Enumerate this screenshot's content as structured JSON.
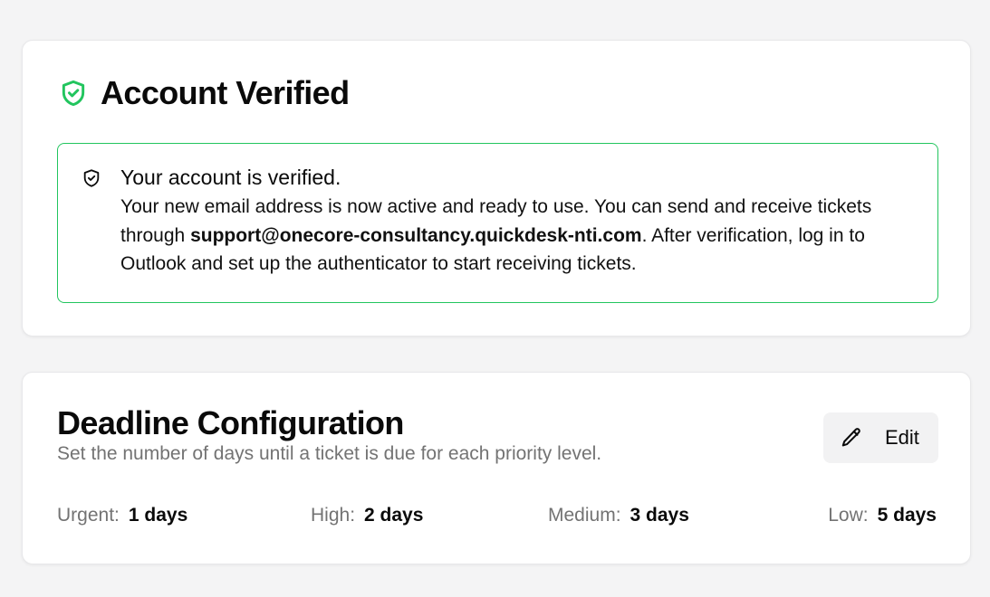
{
  "verified_card": {
    "title": "Account Verified",
    "title_icon": "shield-check-icon",
    "accent_color": "#22c55e",
    "alert": {
      "icon": "shield-check-icon",
      "heading": "Your account is verified.",
      "text_before": "Your new email address is now active and ready to use. You can send and receive tickets through ",
      "email": "support@onecore-consultancy.quickdesk-nti.com",
      "text_after": ". After verification, log in to Outlook and set up the authenticator to start receiving tickets."
    }
  },
  "deadline_card": {
    "title": "Deadline Configuration",
    "subtitle": "Set the number of days until a ticket is due for each priority level.",
    "edit_button": {
      "label": "Edit",
      "icon": "pencil-icon"
    },
    "priorities": [
      {
        "label": "Urgent:",
        "value": "1 days"
      },
      {
        "label": "High:",
        "value": "2 days"
      },
      {
        "label": "Medium:",
        "value": "3 days"
      },
      {
        "label": "Low:",
        "value": "5 days"
      }
    ]
  }
}
